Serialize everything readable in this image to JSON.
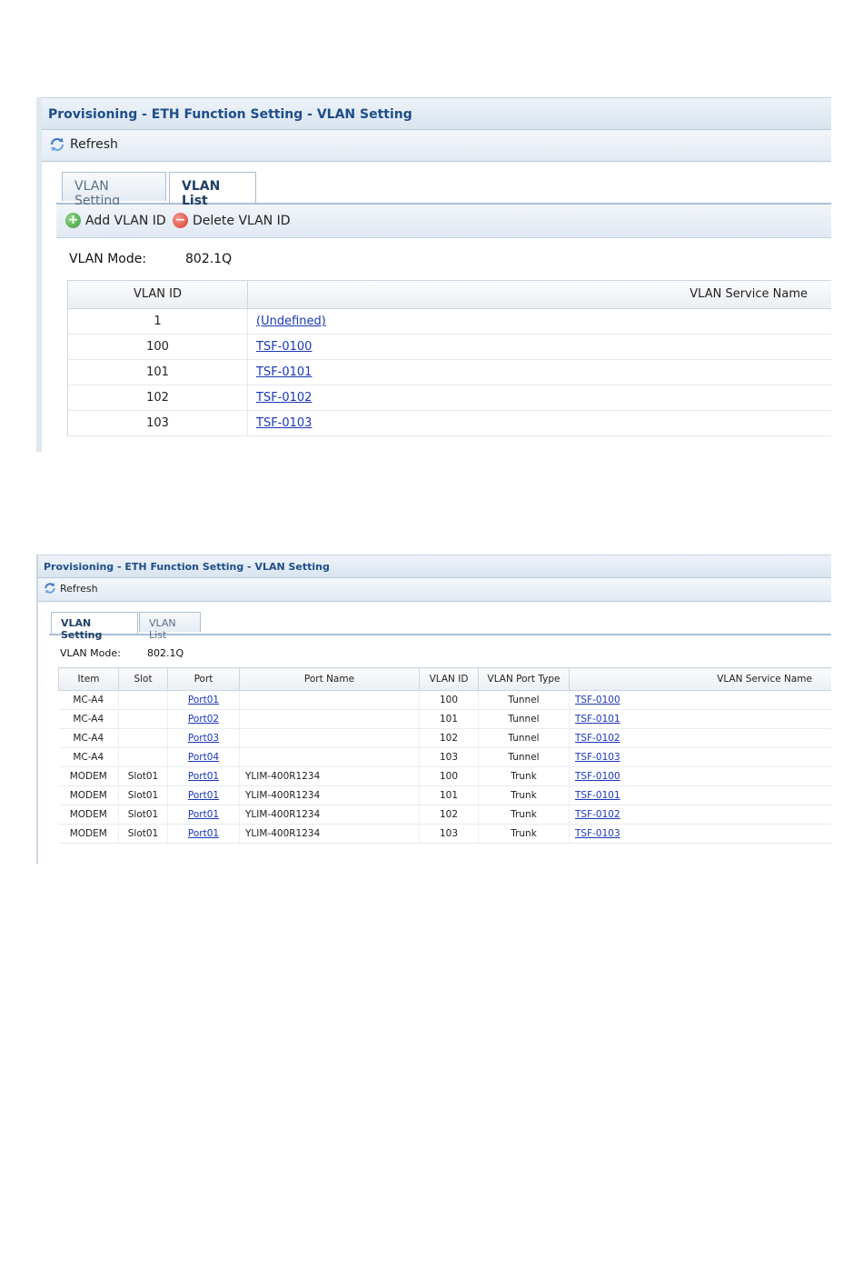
{
  "panel1": {
    "title": "Provisioning - ETH Function Setting - VLAN Setting",
    "refresh_label": "Refresh",
    "tabs": [
      {
        "label": "VLAN Setting",
        "active": false
      },
      {
        "label": "VLAN List",
        "active": true
      }
    ],
    "add_label": "Add VLAN ID",
    "delete_label": "Delete VLAN ID",
    "mode_label": "VLAN Mode:",
    "mode_value": "802.1Q",
    "columns": [
      "VLAN ID",
      "VLAN Service Name"
    ],
    "rows": [
      {
        "id": "1",
        "name": "(Undefined)"
      },
      {
        "id": "100",
        "name": "TSF-0100"
      },
      {
        "id": "101",
        "name": "TSF-0101"
      },
      {
        "id": "102",
        "name": "TSF-0102"
      },
      {
        "id": "103",
        "name": "TSF-0103"
      }
    ],
    "colors": {
      "title": "#1e4e8a",
      "link": "#1a37b5",
      "add_icon": "#4caf50",
      "delete_icon": "#e0463c"
    },
    "icons": {
      "refresh": "refresh-icon",
      "add": "add-circle-icon",
      "delete": "delete-circle-icon"
    }
  },
  "panel2": {
    "title": "Provisioning - ETH Function Setting - VLAN Setting",
    "refresh_label": "Refresh",
    "tabs": [
      {
        "label": "VLAN Setting",
        "active": true
      },
      {
        "label": "VLAN List",
        "active": false
      }
    ],
    "mode_label": "VLAN Mode:",
    "mode_value": "802.1Q",
    "columns": [
      "Item",
      "Slot",
      "Port",
      "Port Name",
      "VLAN ID",
      "VLAN Port Type",
      "VLAN Service Name"
    ],
    "rows": [
      {
        "item": "MC-A4",
        "slot": "",
        "port": "Port01",
        "port_name": "",
        "vlan_id": "100",
        "type": "Tunnel",
        "service": "TSF-0100"
      },
      {
        "item": "MC-A4",
        "slot": "",
        "port": "Port02",
        "port_name": "",
        "vlan_id": "101",
        "type": "Tunnel",
        "service": "TSF-0101"
      },
      {
        "item": "MC-A4",
        "slot": "",
        "port": "Port03",
        "port_name": "",
        "vlan_id": "102",
        "type": "Tunnel",
        "service": "TSF-0102"
      },
      {
        "item": "MC-A4",
        "slot": "",
        "port": "Port04",
        "port_name": "",
        "vlan_id": "103",
        "type": "Tunnel",
        "service": "TSF-0103"
      },
      {
        "item": "MODEM",
        "slot": "Slot01",
        "port": "Port01",
        "port_name": "YLIM-400R1234",
        "vlan_id": "100",
        "type": "Trunk",
        "service": "TSF-0100"
      },
      {
        "item": "MODEM",
        "slot": "Slot01",
        "port": "Port01",
        "port_name": "YLIM-400R1234",
        "vlan_id": "101",
        "type": "Trunk",
        "service": "TSF-0101"
      },
      {
        "item": "MODEM",
        "slot": "Slot01",
        "port": "Port01",
        "port_name": "YLIM-400R1234",
        "vlan_id": "102",
        "type": "Trunk",
        "service": "TSF-0102"
      },
      {
        "item": "MODEM",
        "slot": "Slot01",
        "port": "Port01",
        "port_name": "YLIM-400R1234",
        "vlan_id": "103",
        "type": "Trunk",
        "service": "TSF-0103"
      }
    ],
    "icons": {
      "refresh": "refresh-icon"
    }
  }
}
